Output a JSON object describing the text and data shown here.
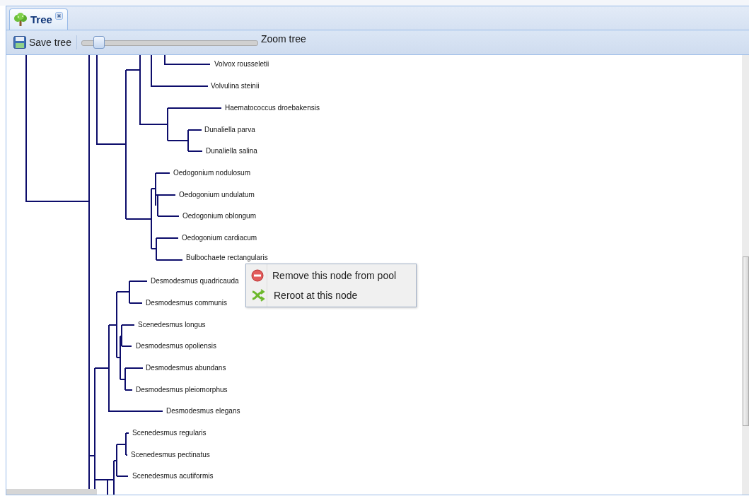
{
  "tabs": [
    {
      "label": "Tree",
      "selected": true
    }
  ],
  "toolbar": {
    "save_button": "Save tree",
    "zoom_slider": {
      "level": 0.05,
      "label": "Zoom tree"
    }
  },
  "tree": {
    "leaves": [
      "Volvox rousseletii",
      "Volvulina steinii",
      "Haematococcus droebakensis",
      "Dunaliella parva",
      "Dunaliella salina",
      "Oedogonium nodulosum",
      "Oedogonium undulatum",
      "Oedogonium oblongum",
      "Oedogonium cardiacum",
      "Bulbochaete rectangularis",
      "Desmodesmus quadricauda",
      "Desmodesmus communis",
      "Scenedesmus longus",
      "Desmodesmus opoliensis",
      "Desmodesmus abundans",
      "Desmodesmus pleiomorphus",
      "Desmodesmus elegans",
      "Scenedesmus regularis",
      "Scenedesmus pectinatus",
      "Scenedesmus acutiformis"
    ]
  },
  "context_menu": {
    "items": [
      {
        "kind": "remove",
        "label": "Remove this node from pool"
      },
      {
        "kind": "reroot",
        "label": "Reroot at this node"
      }
    ]
  }
}
